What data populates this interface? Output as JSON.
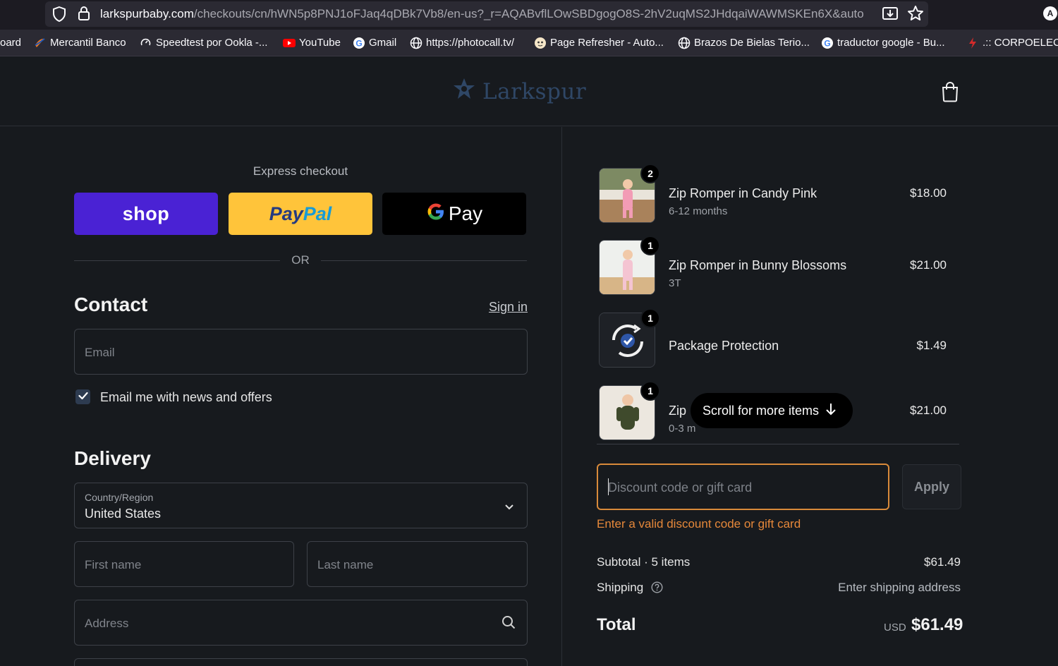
{
  "browser": {
    "url_host": "larkspurbaby.com",
    "url_path": "/checkouts/cn/hWN5p8PNJ1oFJaq4qDBk7Vb8/en-us?_r=AQABvflLOwSBDgogO8S-2hV2uqMS2JHdqaiWAWMSKEn6X&auto",
    "profile_initial": "A",
    "bookmarks": [
      {
        "label": "oard",
        "icon": "none"
      },
      {
        "label": "Mercantil Banco",
        "icon": "mercantil-icon"
      },
      {
        "label": "Speedtest por Ookla -...",
        "icon": "speedtest-icon"
      },
      {
        "label": "YouTube",
        "icon": "youtube-icon"
      },
      {
        "label": "Gmail",
        "icon": "google-icon"
      },
      {
        "label": "https://photocall.tv/",
        "icon": "globe-icon"
      },
      {
        "label": "Page Refresher - Auto...",
        "icon": "refresher-icon"
      },
      {
        "label": "Brazos De Bielas Terio...",
        "icon": "globe-icon"
      },
      {
        "label": "traductor google - Bu...",
        "icon": "google-icon"
      },
      {
        "label": ".:: CORPOELEC :",
        "icon": "corpoelec-icon"
      }
    ]
  },
  "store": {
    "name": "Larkspur"
  },
  "express": {
    "title": "Express checkout",
    "shop_label": "shop",
    "paypal_a": "Pay",
    "paypal_b": "Pal",
    "gpay_label": "Pay",
    "or_label": "OR"
  },
  "contact": {
    "heading": "Contact",
    "signin_label": "Sign in",
    "email_placeholder": "Email",
    "news_label": "Email me with news and offers",
    "news_checked": true
  },
  "delivery": {
    "heading": "Delivery",
    "country_label": "Country/Region",
    "country_value": "United States",
    "first_name_placeholder": "First name",
    "last_name_placeholder": "Last name",
    "address_placeholder": "Address"
  },
  "order": {
    "items": [
      {
        "qty": "2",
        "name": "Zip Romper in Candy Pink",
        "variant": "6-12 months",
        "price": "$18.00"
      },
      {
        "qty": "1",
        "name": "Zip Romper in Bunny Blossoms",
        "variant": "3T",
        "price": "$21.00"
      },
      {
        "qty": "1",
        "name": "Package Protection",
        "variant": "",
        "price": "$1.49"
      },
      {
        "qty": "1",
        "name": "Zip",
        "variant": "0-3 m",
        "price": "$21.00"
      }
    ],
    "scroll_hint": "Scroll for more items"
  },
  "discount": {
    "placeholder": "Discount code or gift card",
    "apply_label": "Apply",
    "error": "Enter a valid discount code or gift card"
  },
  "summary": {
    "subtotal_label": "Subtotal · 5 items",
    "subtotal_value": "$61.49",
    "shipping_label": "Shipping",
    "shipping_value": "Enter shipping address",
    "total_label": "Total",
    "currency": "USD",
    "total_value": "$61.49"
  },
  "colors": {
    "background": "#171a1e",
    "shop_pay": "#4a22d4",
    "paypal": "#ffc43a",
    "discount_border": "#d98a3a",
    "error_text": "#e6883a"
  }
}
